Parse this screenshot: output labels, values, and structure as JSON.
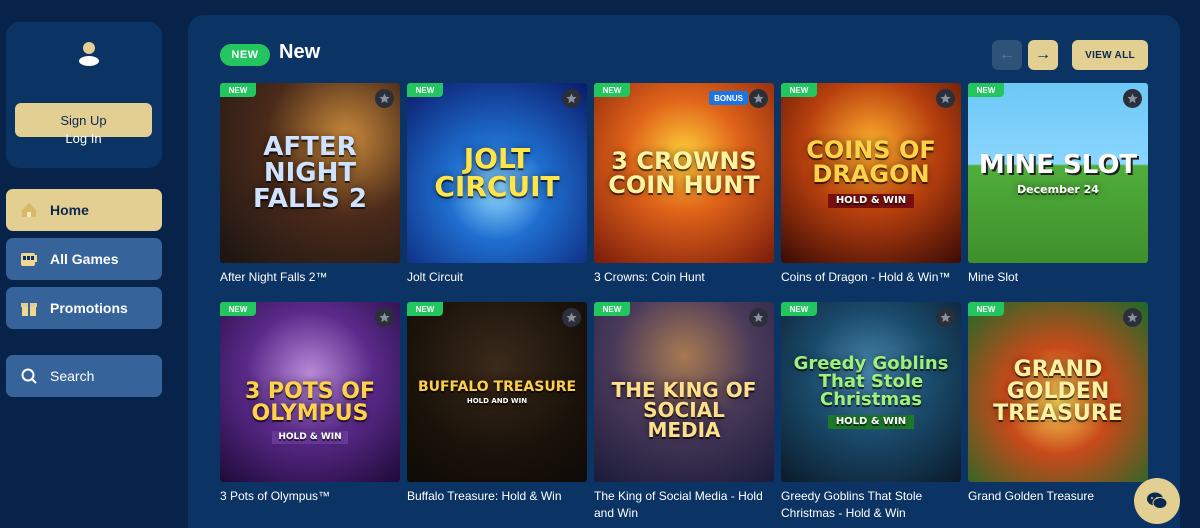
{
  "auth": {
    "signup_label": "Sign Up",
    "login_label": "Log In"
  },
  "nav": {
    "home": "Home",
    "all_games": "All Games",
    "promotions": "Promotions",
    "search": "Search"
  },
  "section": {
    "badge": "NEW",
    "title": "New",
    "view_all": "VIEW ALL"
  },
  "tags": {
    "new": "NEW",
    "bonus": "BONUS"
  },
  "games": [
    {
      "name": "After Night Falls 2™",
      "art": "AFTER NIGHT FALLS 2"
    },
    {
      "name": "Jolt Circuit",
      "art": "JOLT CIRCUIT"
    },
    {
      "name": "3 Crowns: Coin Hunt",
      "art": "3 CROWNS COIN HUNT"
    },
    {
      "name": "Coins of Dragon - Hold & Win™",
      "art": "COINS OF DRAGON",
      "art_sub": "HOLD & WIN"
    },
    {
      "name": "Mine Slot",
      "art": "MINE SLOT",
      "art_sub": "December 24"
    },
    {
      "name": "3 Pots of Olympus™",
      "art": "3 POTS OF OLYMPUS",
      "art_sub": "HOLD & WIN"
    },
    {
      "name": "Buffalo Treasure: Hold & Win",
      "art": "BUFFALO TREASURE",
      "art_sub": "HOLD AND WIN"
    },
    {
      "name": "The King of Social Media - Hold and Win",
      "art": "THE KING OF SOCIAL MEDIA"
    },
    {
      "name": "Greedy Goblins That Stole Christmas - Hold & Win",
      "art": "Greedy Goblins That Stole Christmas",
      "art_sub": "HOLD & WIN"
    },
    {
      "name": "Grand Golden Treasure",
      "art": "GRAND GOLDEN TREASURE"
    }
  ],
  "colors": {
    "page_bg": "#07234a",
    "panel_bg": "#0b3464",
    "accent_gold": "#e4cf92",
    "nav_blue": "#36639a",
    "new_green": "#22c55e"
  },
  "icons": {
    "user": "user-icon",
    "home": "home-icon",
    "games": "slot-machine-icon",
    "promos": "gift-icon",
    "search": "search-icon",
    "prev": "arrow-left-icon",
    "next": "arrow-right-icon",
    "fav": "star-icon",
    "chat": "chat-icon"
  }
}
